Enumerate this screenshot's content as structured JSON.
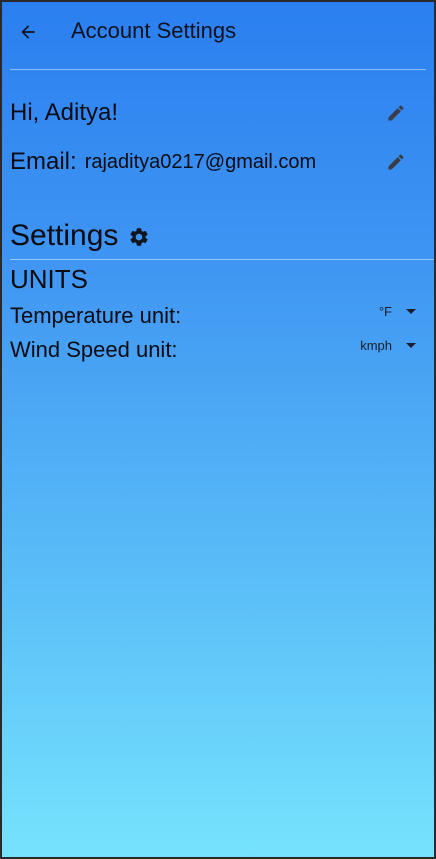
{
  "appbar": {
    "back_icon": "arrow-left-icon",
    "title": "Account Settings"
  },
  "profile": {
    "greeting": "Hi, Aditya!",
    "email_label": "Email:",
    "email_value": "rajaditya0217@gmail.com",
    "edit_icon": "pencil-icon"
  },
  "settings": {
    "heading": "Settings",
    "heading_icon": "gear-icon",
    "units_heading": "UNITS",
    "temperature": {
      "label": "Temperature unit:",
      "selected": "°F"
    },
    "wind": {
      "label": "Wind Speed unit:",
      "selected": "kmph"
    }
  },
  "colors": {
    "gradient_top": "#2b7ff0",
    "gradient_bottom": "#76e3fd",
    "text": "#0b0b12"
  }
}
